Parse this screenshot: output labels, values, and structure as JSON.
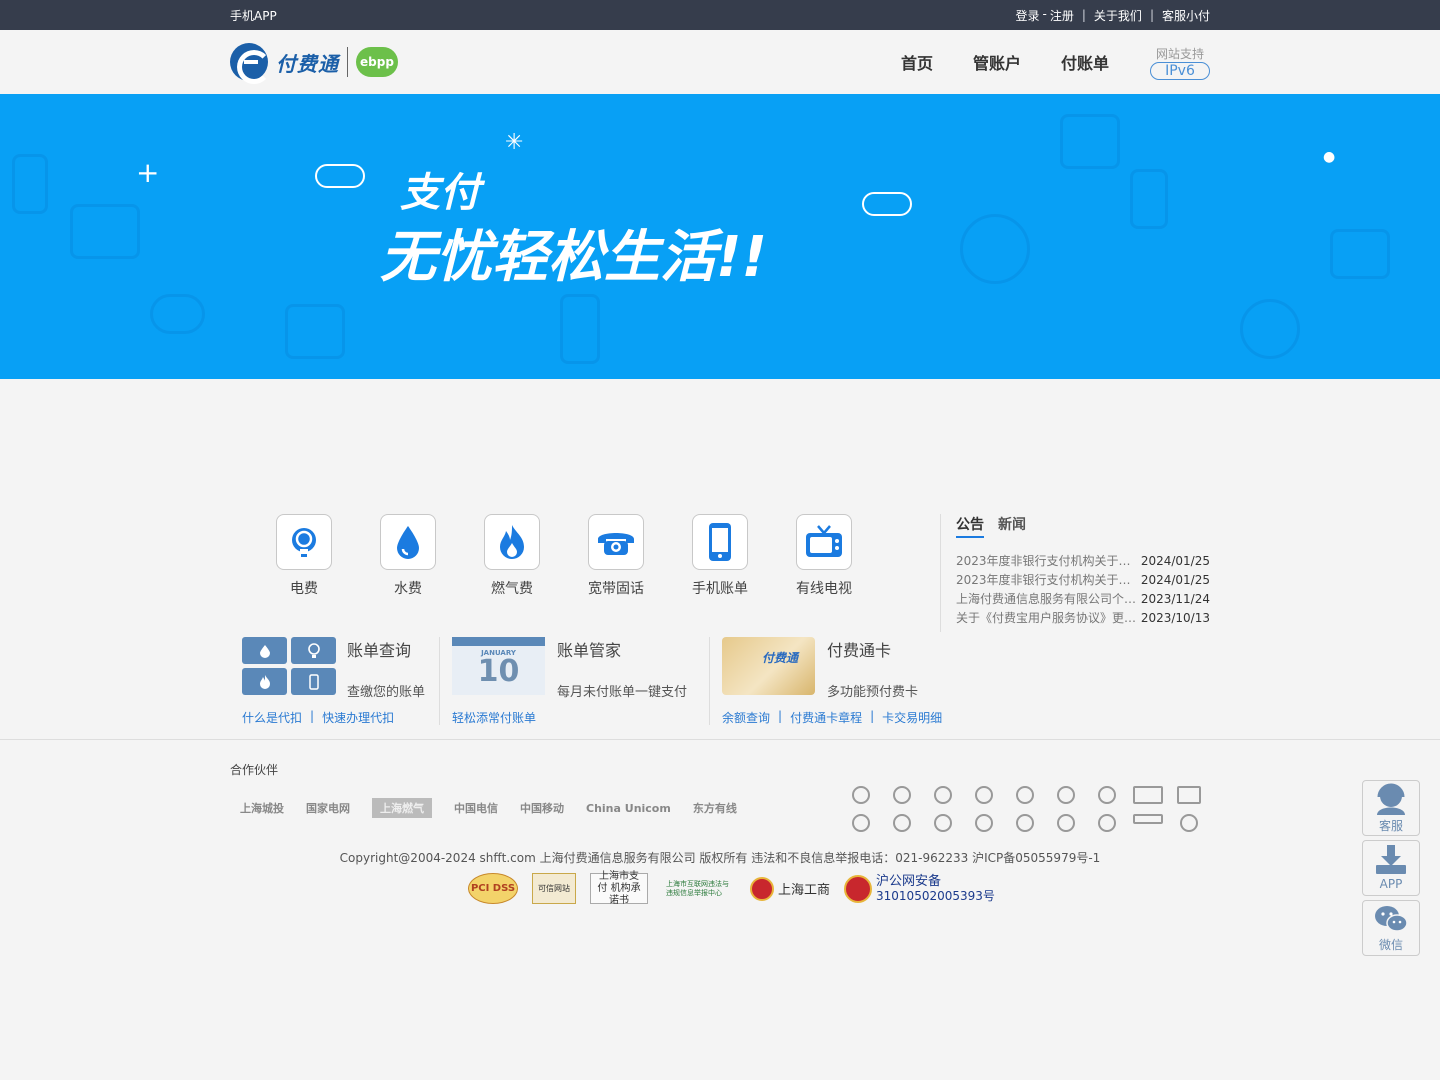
{
  "topbar": {
    "app_link": "手机APP",
    "login": "登录",
    "dash": "-",
    "register": "注册",
    "about": "关于我们",
    "service": "客服小付",
    "sep": "|"
  },
  "header": {
    "logo_text": "付费通",
    "ebpp_text": "ebpp",
    "nav": [
      "首页",
      "管账户",
      "付账单"
    ],
    "ipv6_title": "网站支持",
    "ipv6_badge": "IPv6"
  },
  "banner": {
    "line1": "支付",
    "line2": "无忧轻松生活!!"
  },
  "services": [
    {
      "label": "电费",
      "icon": "lightbulb-icon"
    },
    {
      "label": "水费",
      "icon": "water-drop-icon"
    },
    {
      "label": "燃气费",
      "icon": "flame-icon"
    },
    {
      "label": "宽带固话",
      "icon": "telephone-icon"
    },
    {
      "label": "手机账单",
      "icon": "mobile-phone-icon"
    },
    {
      "label": "有线电视",
      "icon": "tv-icon"
    }
  ],
  "news": {
    "tabs": [
      "公告",
      "新闻"
    ],
    "items": [
      {
        "title": "2023年度非银行支付机构关于…",
        "date": "2024/01/25"
      },
      {
        "title": "2023年度非银行支付机构关于…",
        "date": "2024/01/25"
      },
      {
        "title": "上海付费通信息服务有限公司个…",
        "date": "2023/11/24"
      },
      {
        "title": "关于《付费宝用户服务协议》更…",
        "date": "2023/10/13"
      }
    ]
  },
  "features": {
    "bill_query": {
      "title": "账单查询",
      "desc": "查缴您的账单",
      "links": [
        "什么是代扣",
        "快速办理代扣"
      ]
    },
    "bill_manager": {
      "title": "账单管家",
      "desc": "每月未付账单一键支付",
      "links": [
        "轻松添常付账单"
      ],
      "calendar_month": "JANUARY",
      "calendar_day": "10"
    },
    "card": {
      "title": "付费通卡",
      "desc": "多功能预付费卡",
      "card_text": "付费通",
      "links": [
        "余额查询",
        "付费通卡章程",
        "卡交易明细"
      ]
    },
    "link_sep": "|"
  },
  "footer": {
    "partners_title": "合作伙伴",
    "partners": [
      "上海城投",
      "国家电网",
      "上海燃气",
      "中国电信",
      "中国移动",
      "China Unicom",
      "东方有线"
    ],
    "copyright": "Copyright@2004-2024 shfft.com 上海付费通信息服务有限公司 版权所有   违法和不良信息举报电话：021-962233  沪ICP备05055979号-1",
    "badges": {
      "pci": "PCI DSS",
      "cert": "可信网站",
      "commit": "上海市支付 机构承诺书",
      "report": "上海市互联网违法与违规信息举报中心",
      "gongshang": "上海工商",
      "police_title": "沪公网安备",
      "police_no": "31010502005393号"
    }
  },
  "side": [
    {
      "label": "客服",
      "icon": "customer-service-icon"
    },
    {
      "label": "APP",
      "icon": "download-icon"
    },
    {
      "label": "微信",
      "icon": "wechat-icon"
    }
  ],
  "colors": {
    "topbar_bg": "#363d4c",
    "banner_bg": "#08a0f5",
    "brand_blue": "#1b5fa8",
    "link_blue": "#2a7ad2",
    "icon_blue": "#1b7be0"
  }
}
